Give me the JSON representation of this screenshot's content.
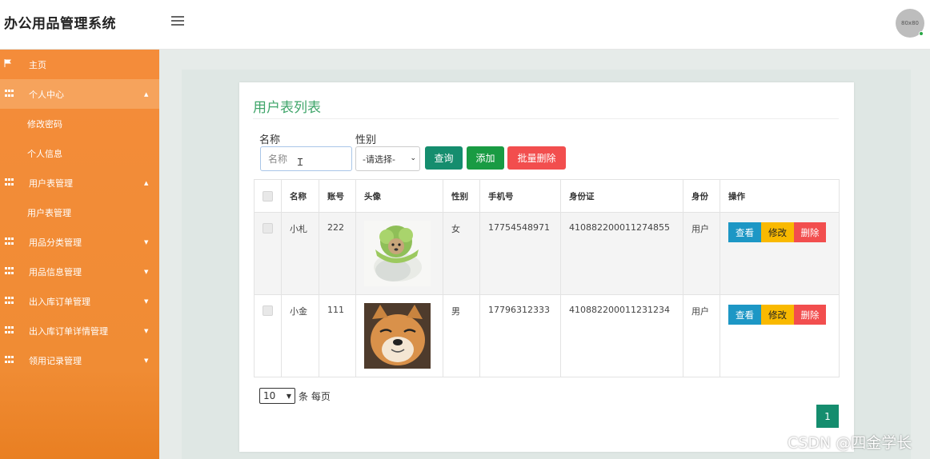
{
  "app": {
    "title": "办公用品管理系统"
  },
  "header": {
    "avatar_text": "80x80"
  },
  "sidebar": {
    "items": [
      {
        "label": "主页",
        "icon": "flag-icon"
      },
      {
        "label": "个人中心",
        "icon": "grid-icon",
        "expanded": true,
        "children": [
          "修改密码",
          "个人信息"
        ]
      },
      {
        "label": "用户表管理",
        "icon": "grid-icon",
        "expanded": true,
        "children": [
          "用户表管理"
        ]
      },
      {
        "label": "用品分类管理",
        "icon": "grid-icon",
        "expanded": false
      },
      {
        "label": "用品信息管理",
        "icon": "grid-icon",
        "expanded": false
      },
      {
        "label": "出入库订单管理",
        "icon": "grid-icon",
        "expanded": false
      },
      {
        "label": "出入库订单详情管理",
        "icon": "grid-icon",
        "expanded": false
      },
      {
        "label": "领用记录管理",
        "icon": "grid-icon",
        "expanded": false
      }
    ]
  },
  "panel": {
    "title": "用户表列表",
    "filters": {
      "name_label": "名称",
      "name_placeholder": "名称",
      "gender_label": "性别",
      "gender_value": "-请选择-"
    },
    "buttons": {
      "query": "查询",
      "add": "添加",
      "batch_delete": "批量删除"
    },
    "table": {
      "columns": [
        "名称",
        "账号",
        "头像",
        "性别",
        "手机号",
        "身份证",
        "身份",
        "操作"
      ],
      "rows": [
        {
          "name": "小札",
          "account": "222",
          "avatar": "cabbage-dog-image",
          "gender": "女",
          "phone": "17754548971",
          "id_card": "410882200011274855",
          "role": "用户"
        },
        {
          "name": "小金",
          "account": "111",
          "avatar": "shiba-inu-image",
          "gender": "男",
          "phone": "17796312333",
          "id_card": "410882200011231234",
          "role": "用户"
        }
      ],
      "actions": {
        "view": "查看",
        "edit": "修改",
        "delete": "删除"
      }
    },
    "pagination": {
      "page_size": "10",
      "page_size_label": "条 每页",
      "current_page": "1"
    }
  },
  "colors": {
    "sidebar": "#f48c3a",
    "title": "#3fa56a",
    "query": "#158d6e",
    "add": "#199b43",
    "danger": "#f24e4e",
    "view": "#1d97c5",
    "edit": "#f9b900"
  },
  "watermark": "CSDN @四金学长"
}
